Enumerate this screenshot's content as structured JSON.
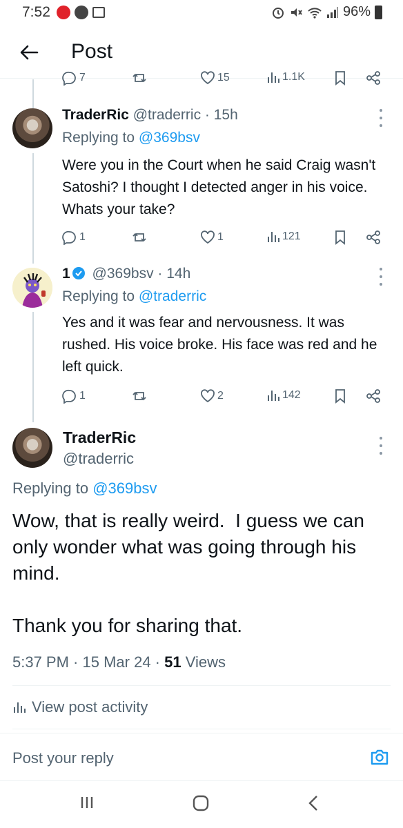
{
  "status_bar": {
    "time": "7:52",
    "battery": "96%"
  },
  "header": {
    "title": "Post"
  },
  "top_actions": {
    "replies": "7",
    "likes": "15",
    "views": "1.1K"
  },
  "replies": [
    {
      "name": "TraderRic",
      "handle": "@traderric",
      "age": "· 15h",
      "replying_prefix": "Replying to",
      "replying_to": "@369bsv",
      "text": "Were you in the Court when he said Craig wasn't Satoshi? I thought I detected anger in his voice. Whats your take?",
      "stats": {
        "replies": "1",
        "reposts": "",
        "likes": "1",
        "views": "121"
      }
    },
    {
      "name": "1",
      "handle": "@369bsv",
      "age": "· 14h",
      "replying_prefix": "Replying to",
      "replying_to": "@traderric",
      "text": "Yes and it was fear and nervousness. It was rushed. His voice broke. His face was red and he left quick.",
      "stats": {
        "replies": "1",
        "reposts": "",
        "likes": "2",
        "views": "142"
      }
    }
  ],
  "main_post": {
    "name": "TraderRic",
    "handle": "@traderric",
    "replying_prefix": "Replying to",
    "replying_to": "@369bsv",
    "text_p1": "Wow, that is really weird.  I guess we can only wonder what was going through his mind.",
    "text_p2": "Thank you for sharing that.",
    "time": "5:37 PM",
    "date": "15 Mar 24",
    "views_count": "51",
    "views_label": "Views",
    "activity_label": "View post activity"
  },
  "reply_bar": {
    "placeholder": "Post your reply"
  },
  "colors": {
    "accent": "#1d9bf0",
    "secondary_text": "#536471",
    "primary_text": "#0f1419",
    "divider": "#eff3f4"
  }
}
